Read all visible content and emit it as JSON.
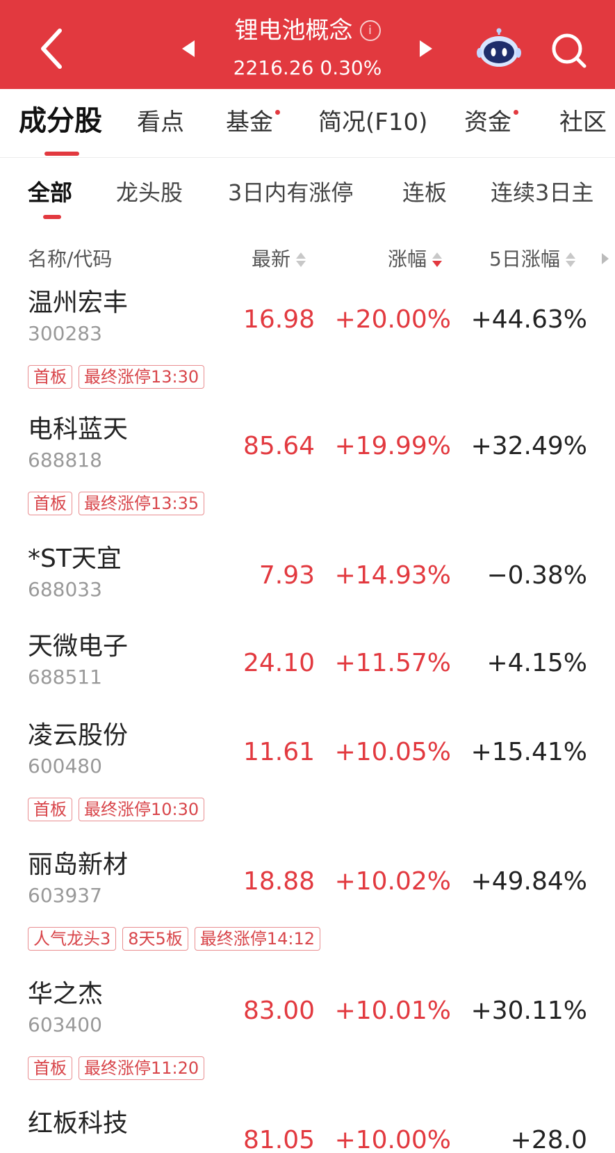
{
  "header": {
    "title": "锂电池概念",
    "info_icon_glyph": "i",
    "index_value": "2216.26",
    "index_change": "0.30%"
  },
  "main_tabs": [
    {
      "label": "成分股",
      "active": true,
      "dot": false
    },
    {
      "label": "看点",
      "active": false,
      "dot": false
    },
    {
      "label": "基金",
      "active": false,
      "dot": true
    },
    {
      "label": "简况(F10)",
      "active": false,
      "dot": false
    },
    {
      "label": "资金",
      "active": false,
      "dot": true
    },
    {
      "label": "社区",
      "active": false,
      "dot": false
    }
  ],
  "sub_tabs": [
    {
      "label": "全部",
      "active": true
    },
    {
      "label": "龙头股",
      "active": false
    },
    {
      "label": "3日内有涨停",
      "active": false
    },
    {
      "label": "连板",
      "active": false
    },
    {
      "label": "连续3日主",
      "active": false
    }
  ],
  "columns": {
    "name": "名称/代码",
    "latest": "最新",
    "change": "涨幅",
    "change5": "5日涨幅"
  },
  "rows": [
    {
      "name": "温州宏丰",
      "code": "300283",
      "price": "16.98",
      "change": "+20.00%",
      "change5": "+44.63%",
      "tags": [
        "首板",
        "最终涨停13:30"
      ]
    },
    {
      "name": "电科蓝天",
      "code": "688818",
      "price": "85.64",
      "change": "+19.99%",
      "change5": "+32.49%",
      "tags": [
        "首板",
        "最终涨停13:35"
      ]
    },
    {
      "name": "*ST天宜",
      "code": "688033",
      "price": "7.93",
      "change": "+14.93%",
      "change5": "−0.38%",
      "tags": []
    },
    {
      "name": "天微电子",
      "code": "688511",
      "price": "24.10",
      "change": "+11.57%",
      "change5": "+4.15%",
      "tags": []
    },
    {
      "name": "凌云股份",
      "code": "600480",
      "price": "11.61",
      "change": "+10.05%",
      "change5": "+15.41%",
      "tags": [
        "首板",
        "最终涨停10:30"
      ]
    },
    {
      "name": "丽岛新材",
      "code": "603937",
      "price": "18.88",
      "change": "+10.02%",
      "change5": "+49.84%",
      "tags": [
        "人气龙头3",
        "8天5板",
        "最终涨停14:12"
      ]
    },
    {
      "name": "华之杰",
      "code": "603400",
      "price": "83.00",
      "change": "+10.01%",
      "change5": "+30.11%",
      "tags": [
        "首板",
        "最终涨停11:20"
      ]
    },
    {
      "name": "红板科技",
      "code": "",
      "price": "81.05",
      "change": "+10.00%",
      "change5": "+28.0",
      "tags": []
    }
  ],
  "colors": {
    "brand_red": "#e2393f",
    "tag_red": "#d8454a",
    "muted_gray": "#999999"
  }
}
